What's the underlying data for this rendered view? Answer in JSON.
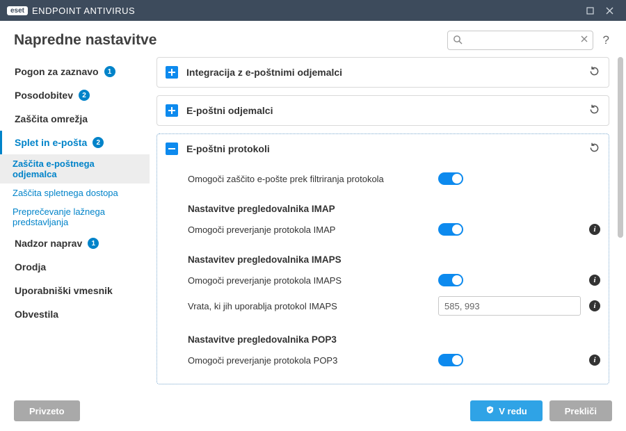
{
  "app": {
    "brand": "eset",
    "product": "ENDPOINT ANTIVIRUS"
  },
  "header": {
    "title": "Napredne nastavitve",
    "search_placeholder": ""
  },
  "sidebar": [
    {
      "label": "Pogon za zaznavo",
      "badge": "1",
      "type": "top"
    },
    {
      "label": "Posodobitev",
      "badge": "2",
      "type": "top"
    },
    {
      "label": "Zaščita omrežja",
      "type": "top"
    },
    {
      "label": "Splet in e-pošta",
      "badge": "2",
      "type": "top",
      "active": true
    },
    {
      "label": "Zaščita e-poštnega odjemalca",
      "type": "sub",
      "active": true
    },
    {
      "label": "Zaščita spletnega dostopa",
      "type": "sub"
    },
    {
      "label": "Preprečevanje lažnega predstavljanja",
      "type": "sub"
    },
    {
      "label": "Nadzor naprav",
      "badge": "1",
      "type": "top"
    },
    {
      "label": "Orodja",
      "type": "top"
    },
    {
      "label": "Uporabniški vmesnik",
      "type": "top"
    },
    {
      "label": "Obvestila",
      "type": "top"
    }
  ],
  "panels": {
    "p0": {
      "title": "Integracija z e-poštnimi odjemalci"
    },
    "p1": {
      "title": "E-poštni odjemalci"
    },
    "p2": {
      "title": "E-poštni protokoli",
      "row_enable": "Omogoči zaščito e-pošte prek filtriranja protokola",
      "group_imap": "Nastavitve pregledovalnika IMAP",
      "row_imap": "Omogoči preverjanje protokola IMAP",
      "group_imaps": "Nastavitev pregledovalnika IMAPS",
      "row_imaps": "Omogoči preverjanje protokola IMAPS",
      "row_ports_label": "Vrata, ki jih uporablja protokol IMAPS",
      "row_ports_value": "585, 993",
      "group_pop3": "Nastavitve pregledovalnika POP3",
      "row_pop3": "Omogoči preverjanje protokola POP3"
    }
  },
  "footer": {
    "default": "Privzeto",
    "ok": "V redu",
    "cancel": "Prekliči"
  }
}
